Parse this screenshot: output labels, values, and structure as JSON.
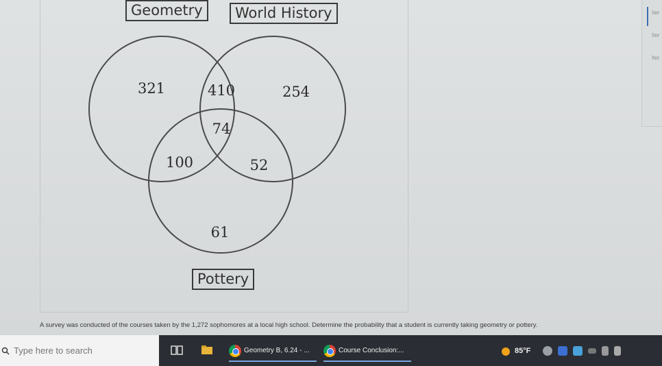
{
  "diagram": {
    "labels": {
      "geometry": "Geometry",
      "world_history": "World History",
      "pottery": "Pottery"
    },
    "regions": {
      "geometry_only": "321",
      "geometry_history": "410",
      "history_only": "254",
      "all_three": "74",
      "geometry_pottery": "100",
      "history_pottery": "52",
      "pottery_only": "61"
    }
  },
  "question": "A survey was conducted of the courses taken by the 1,272 sophomores at a local high school. Determine the probability that a student is currently taking geometry or pottery.",
  "right_panel": {
    "items": [
      "Iter",
      "Iter",
      "Iter"
    ]
  },
  "taskbar": {
    "search_placeholder": "Type here to search",
    "apps": [
      {
        "label": "Geometry B, 6.24 - ...",
        "icon": "chrome-icon"
      },
      {
        "label": "Course Conclusion:...",
        "icon": "chrome-icon"
      }
    ],
    "weather": "85°F"
  },
  "colors": {
    "taskbar_bg": "#2a2d33",
    "circle_stroke": "#4a4a4a",
    "accent": "#7aa6e0"
  }
}
